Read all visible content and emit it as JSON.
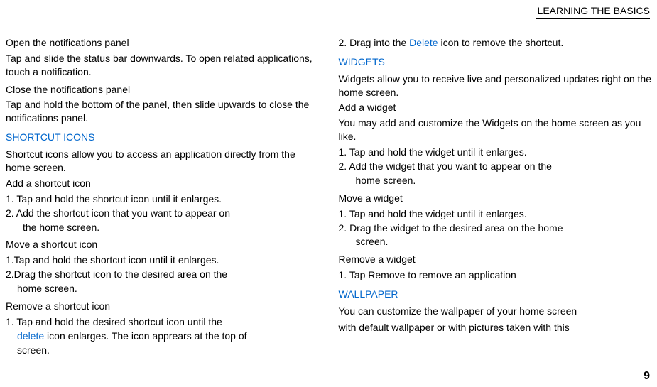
{
  "header": {
    "title": "LEARNING THE BASICS"
  },
  "left": {
    "notif_open_title": "Open the notifications panel",
    "notif_open_body": "Tap and slide the status bar downwards. To open related applications, touch a notification.",
    "notif_close_title": "Close the notifications panel",
    "notif_close_body": "Tap and hold the bottom of the panel, then slide upwards to close the notifications panel.",
    "shortcut_heading": "SHORTCUT ICONS",
    "shortcut_intro": "Shortcut icons allow you to access an application directly from the home screen.",
    "add_shortcut_title": "Add a shortcut icon",
    "add_shortcut_1": "1. Tap and hold the shortcut icon until it enlarges.",
    "add_shortcut_2": "2. Add the shortcut icon that you want to appear on",
    "add_shortcut_2b": "the home screen.",
    "move_shortcut_title": "Move a shortcut icon",
    "move_shortcut_1": "1.Tap and hold the shortcut icon until it enlarges.",
    "move_shortcut_2": "2.Drag the shortcut icon to the desired area on the",
    "move_shortcut_2b": "home screen.",
    "remove_shortcut_title": "Remove a shortcut icon",
    "remove_shortcut_1a": "1. Tap and hold the desired shortcut icon until the",
    "remove_shortcut_delete": "delete",
    "remove_shortcut_1b": " icon enlarges. The icon apprears at the top of",
    "remove_shortcut_1c": "screen."
  },
  "right": {
    "drag_delete_a": "2. Drag into the ",
    "drag_delete_word": "Delete",
    "drag_delete_b": " icon to remove the shortcut.",
    "widgets_heading": "WIDGETS",
    "widgets_intro": "Widgets allow you to receive live and personalized updates right on the home screen.",
    "add_widget_title": "Add a widget",
    "add_widget_intro": "You may add and customize the Widgets on the home screen as you like.",
    "add_widget_1": "1. Tap and hold the widget until it enlarges.",
    "add_widget_2": "2. Add the widget that you want to appear on the",
    "add_widget_2b": "home screen.",
    "move_widget_title": "Move a widget",
    "move_widget_1": "1. Tap and hold the widget until it enlarges.",
    "move_widget_2": "2. Drag the widget to the desired area on the home",
    "move_widget_2b": "screen.",
    "remove_widget_title": "Remove a widget",
    "remove_widget_1": "1. Tap Remove to remove an application",
    "wallpaper_heading": "WALLPAPER",
    "wallpaper_body1": "You can customize the wallpaper of your home screen",
    "wallpaper_body2": "with default wallpaper or with pictures taken with this"
  },
  "page_number": "9"
}
